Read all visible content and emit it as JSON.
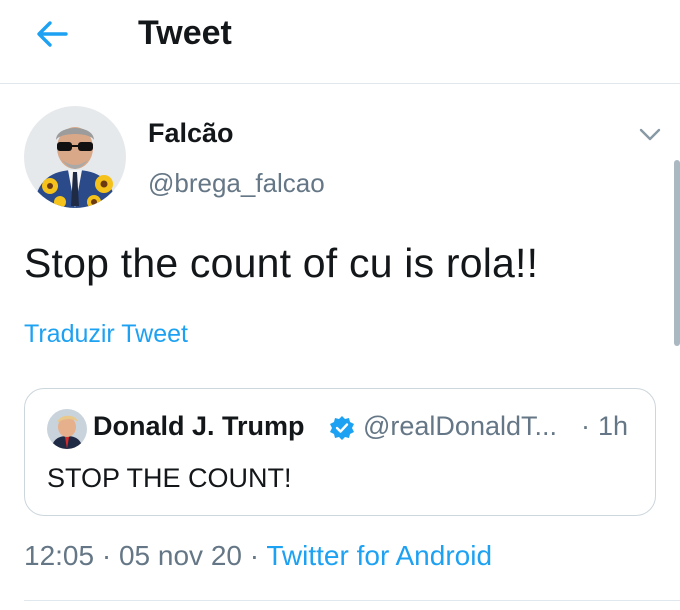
{
  "header": {
    "title": "Tweet",
    "back_icon": "arrow-left-icon"
  },
  "colors": {
    "accent": "#1da1f2",
    "secondary_text": "#657786",
    "primary_text": "#14171a",
    "border": "#ccd6dd"
  },
  "tweet": {
    "author_name": "Falcão",
    "author_handle": "@brega_falcao",
    "text": "Stop the count of cu is rola!!",
    "translate_label": "Traduzir Tweet",
    "time": "12:05",
    "date": "05 nov 20",
    "separator": "·",
    "source": "Twitter for Android"
  },
  "quoted_tweet": {
    "author_name": "Donald J. Trump",
    "author_handle": "@realDonaldT...",
    "separator": "·",
    "time_ago": "1h",
    "text": "STOP THE COUNT!",
    "verified_icon": "verified-badge-icon"
  }
}
